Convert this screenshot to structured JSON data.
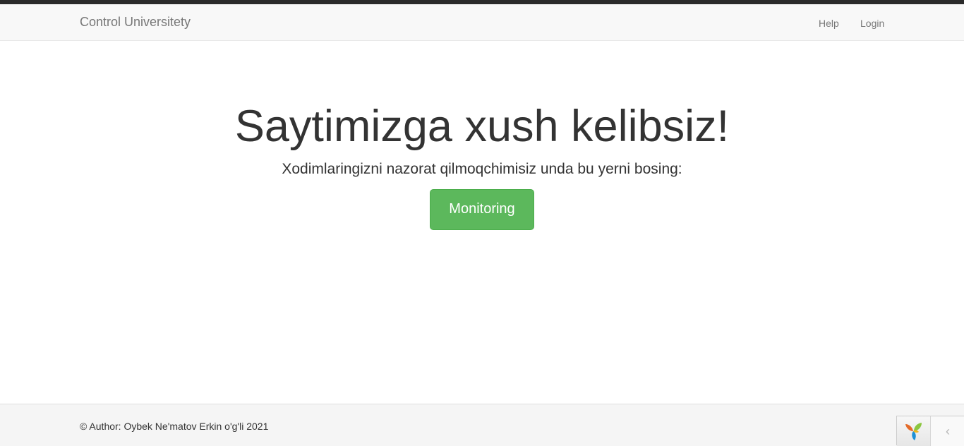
{
  "navbar": {
    "brand": "Control Universitety",
    "items": [
      {
        "label": "Help"
      },
      {
        "label": "Login"
      }
    ]
  },
  "hero": {
    "title": "Saytimizga xush kelibsiz!",
    "lead": "Xodimlaringizni nazorat qilmoqchimisiz unda bu yerni bosing:",
    "button_label": "Monitoring"
  },
  "footer": {
    "text": "© Author: Oybek Ne'matov Erkin o'g'li 2021"
  },
  "debug_toolbar": {
    "logo_icon": "yii-logo-icon",
    "toggle_icon": "chevron-left-icon",
    "toggle_glyph": "‹"
  },
  "colors": {
    "success": "#5cb85c",
    "navbar_bg": "#f8f8f8",
    "top_strip": "#2b2b2b"
  }
}
